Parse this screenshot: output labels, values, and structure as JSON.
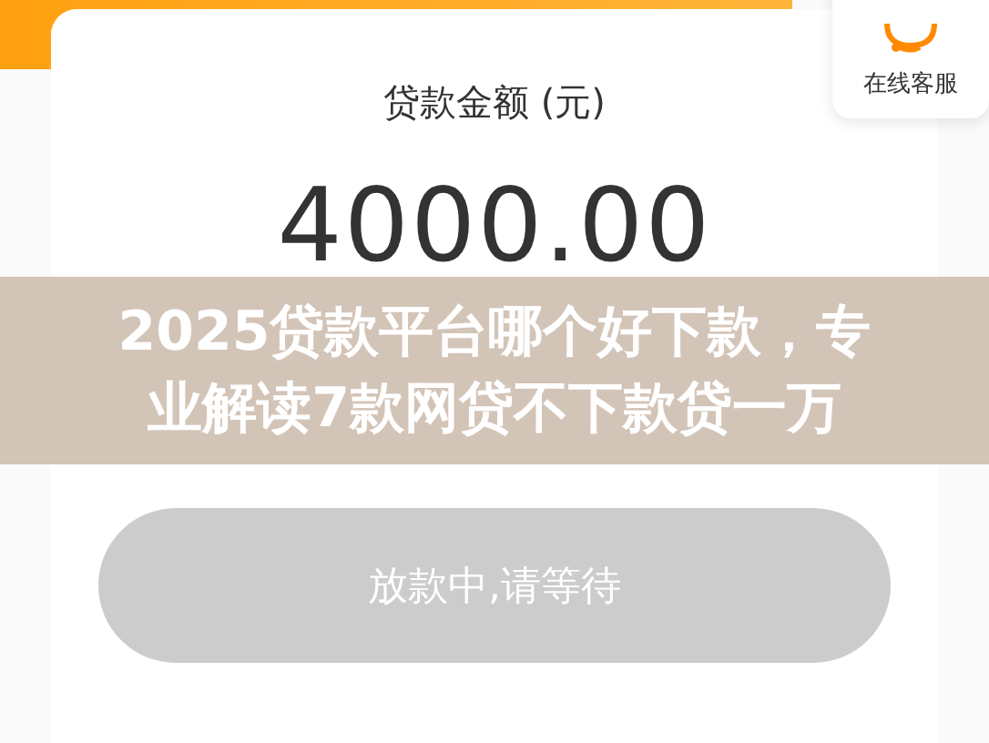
{
  "loan_card": {
    "amount_label": "贷款金额 (元)",
    "amount": "4000.00",
    "status_button": {
      "label": "放款中,请等待",
      "disabled": true
    }
  },
  "customer_service": {
    "label": "在线客服"
  },
  "caption_banner": {
    "lines": [
      "2025贷款平台哪个好下款，专",
      "业解读7款网贷不下款贷一万"
    ]
  }
}
